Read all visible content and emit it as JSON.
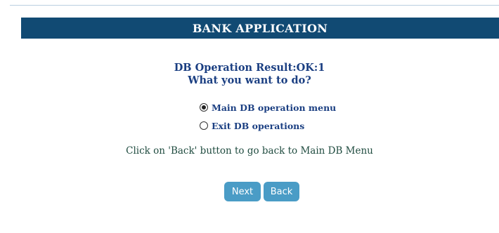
{
  "header": {
    "title": "BANK APPLICATION"
  },
  "result": {
    "status_line": "DB Operation Result:OK:1",
    "question": "What you want to do?"
  },
  "options": [
    {
      "label": "Main DB operation menu",
      "selected": true
    },
    {
      "label": "Exit DB operations",
      "selected": false
    }
  ],
  "hint": "Click on 'Back' button to go back to Main DB Menu",
  "buttons": {
    "next_label": "Next",
    "back_label": "Back"
  },
  "colors": {
    "title_bar": "#114a73",
    "button": "#4a9cc6",
    "heading_text": "#1b3f82",
    "hint_text": "#1f4b3f"
  }
}
